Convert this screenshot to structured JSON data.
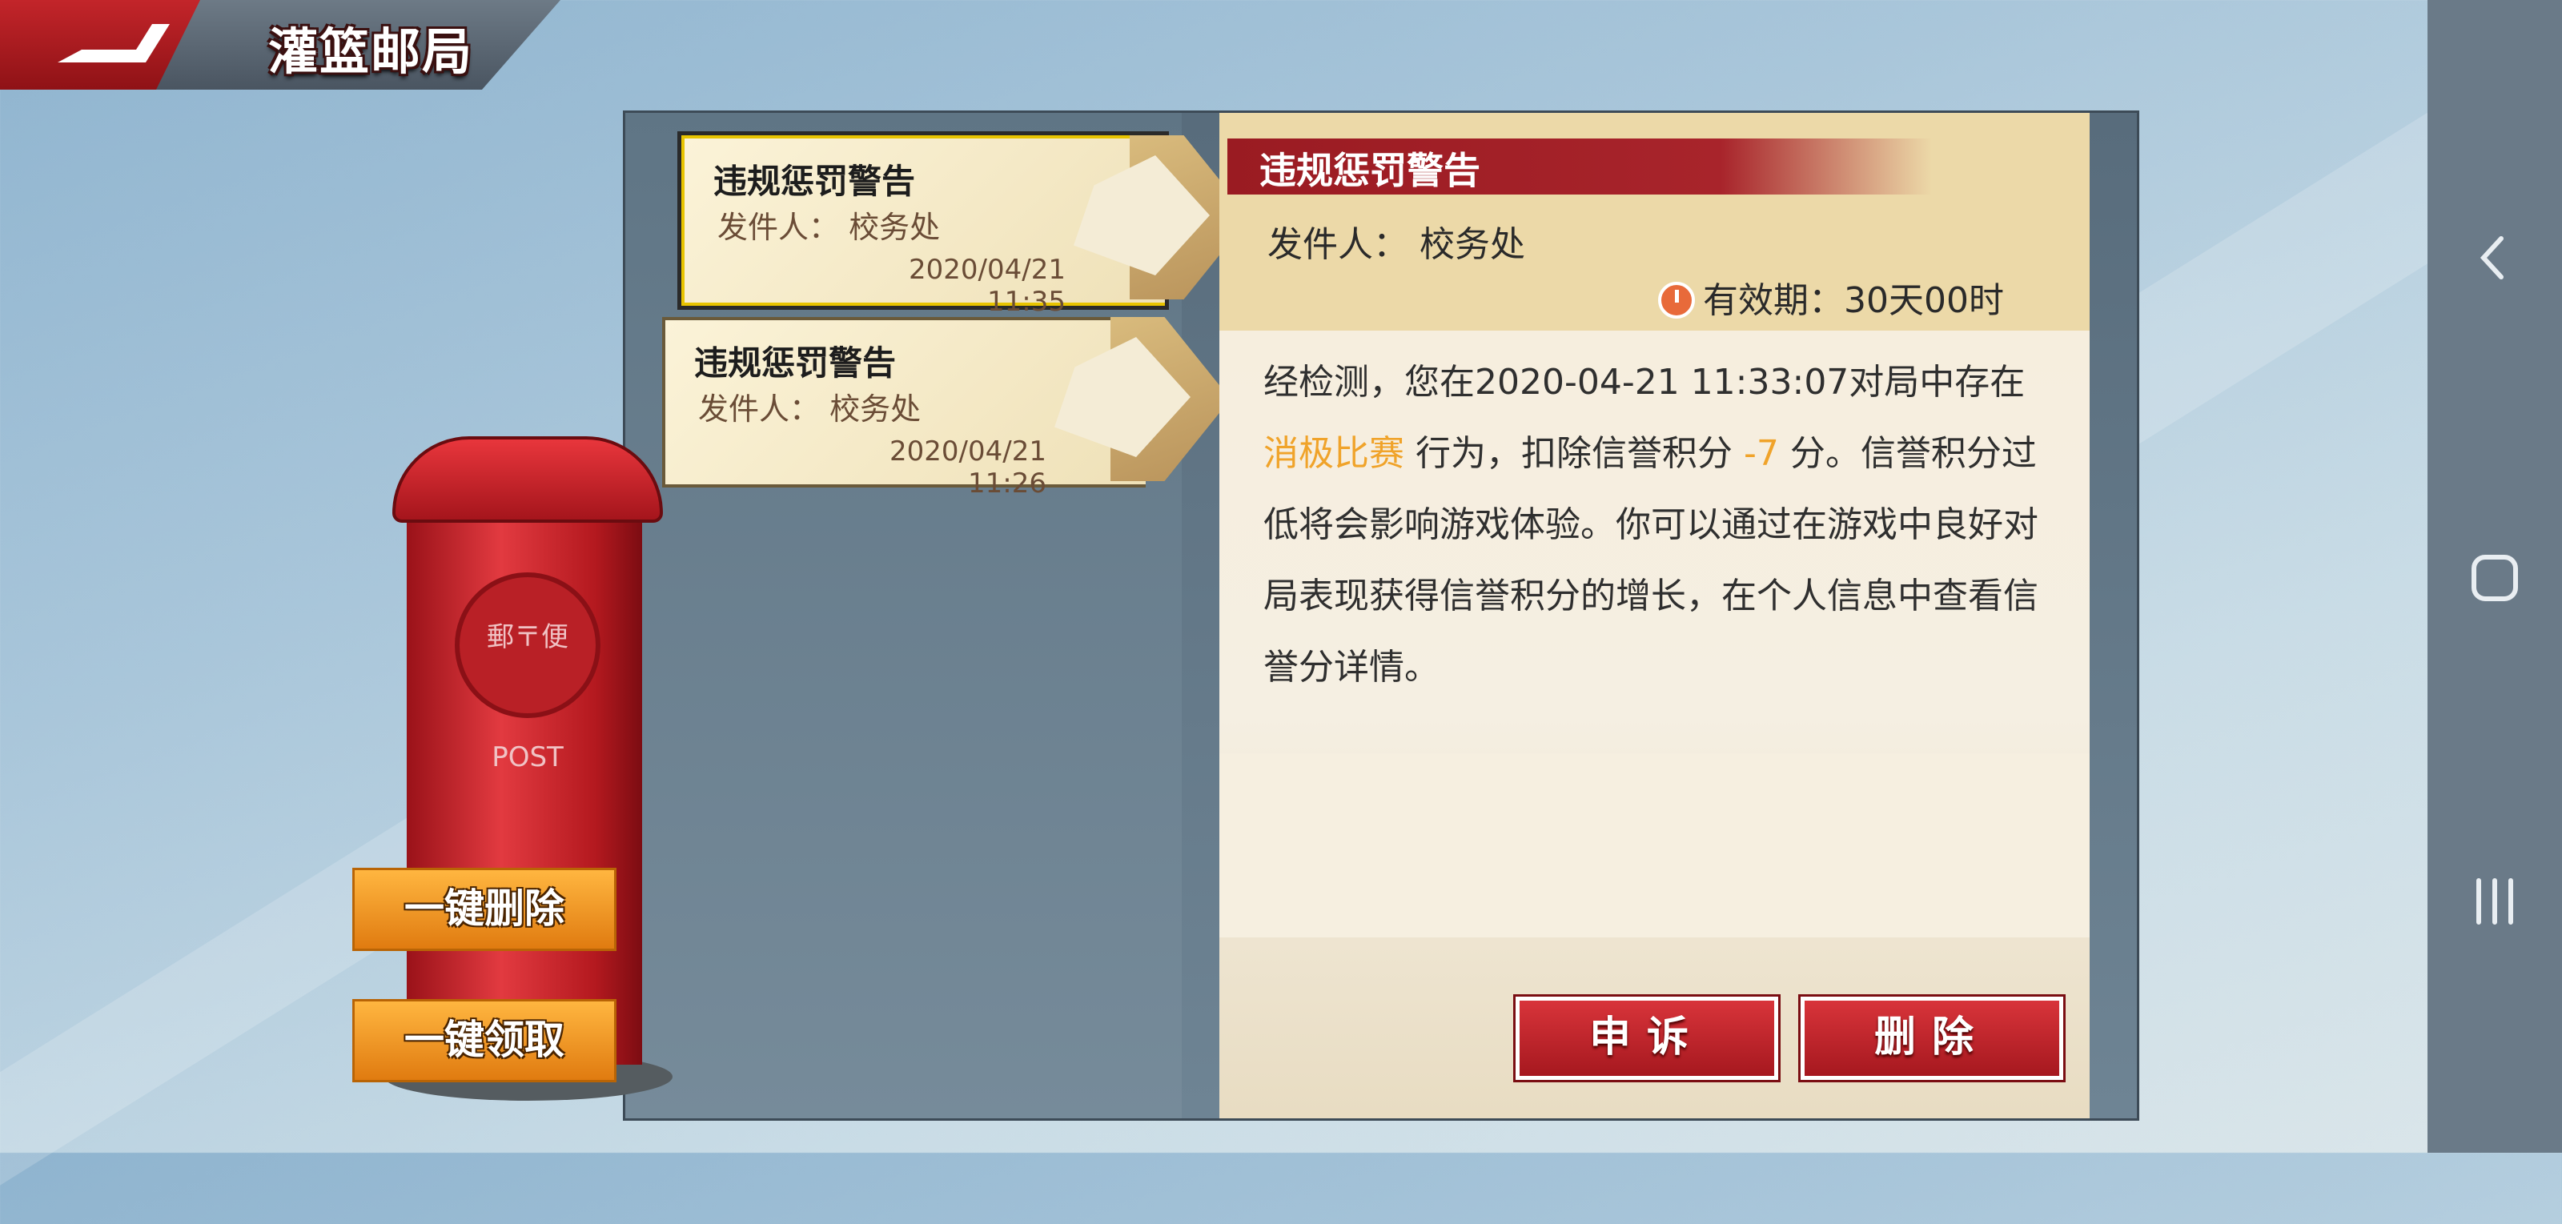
{
  "header": {
    "title": "灌篮邮局",
    "back_icon": "back-arrow-icon"
  },
  "mail_list": [
    {
      "title": "违规惩罚警告",
      "sender_label": "发件人：",
      "sender": "校务处",
      "date": "2020/04/21 11:35",
      "selected": true
    },
    {
      "title": "违规惩罚警告",
      "sender_label": "发件人：",
      "sender": "校务处",
      "date": "2020/04/21 11:26",
      "selected": false
    }
  ],
  "detail": {
    "title": "违规惩罚警告",
    "sender_label": "发件人：",
    "sender": "校务处",
    "validity_label": "有效期：",
    "validity_value": "30天00时",
    "body_pre": "经检测，您在2020-04-21 11:33:07对局中存在 ",
    "body_highlight1": "消极比赛",
    "body_mid": " 行为，扣除信誉积分 ",
    "body_highlight2": "-7",
    "body_post": " 分。信誉积分过低将会影响游戏体验。你可以通过在游戏中良好对局表现获得信誉积分的增长，在个人信息中查看信誉分详情。",
    "highlight_color": "#f0a32a"
  },
  "actions": {
    "appeal": "申诉",
    "delete": "删除"
  },
  "postbox": {
    "emblem_text": "郵〒便 POST"
  },
  "left_buttons": {
    "delete_all": "一键删除",
    "collect_all": "一键领取"
  },
  "system_nav": {
    "back": "back-chevron-icon",
    "home": "home-square-icon",
    "recents": "recents-lines-icon"
  }
}
